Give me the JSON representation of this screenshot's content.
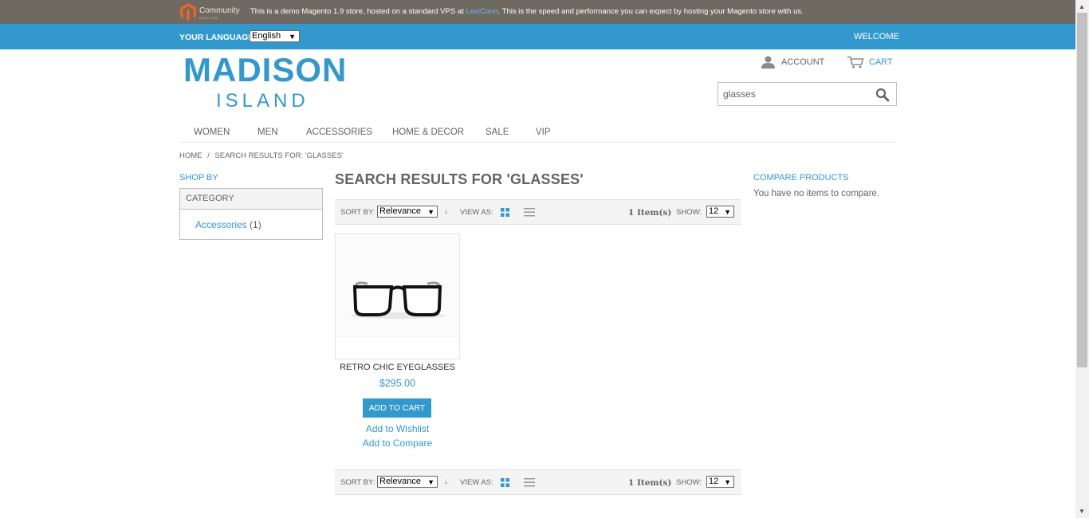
{
  "demo_bar": {
    "logo_text": "Community",
    "logo_sub": "EDITION",
    "text_before": "This is a demo Magento 1.9 store, hosted on a standard VPS at ",
    "link_text": "LexiConn",
    "text_after": ". This is the speed and performance you can expect by hosting your Magento store with us."
  },
  "lang_bar": {
    "label": "YOUR LANGUAGE:",
    "selected_language": "English",
    "welcome": "WELCOME"
  },
  "header": {
    "logo_main": "MADISON",
    "logo_sub": "ISLAND",
    "account_label": "ACCOUNT",
    "cart_label": "CART",
    "search_value": "glasses"
  },
  "nav": {
    "items": [
      "WOMEN",
      "MEN",
      "ACCESSORIES",
      "HOME & DECOR",
      "SALE",
      "VIP"
    ]
  },
  "breadcrumb": {
    "home": "HOME",
    "separator": "/",
    "current": "SEARCH RESULTS FOR: 'GLASSES'"
  },
  "sidebar": {
    "shop_by": "SHOP BY",
    "category_heading": "CATEGORY",
    "category_item": "Accessories",
    "category_count": "(1)"
  },
  "main": {
    "title": "SEARCH RESULTS FOR 'GLASSES'",
    "toolbar": {
      "sort_by_label": "SORT BY:",
      "sort_value": "Relevance",
      "view_as_label": "VIEW AS:",
      "count": "1 Item(s)",
      "show_label": "SHOW:",
      "show_value": "12"
    },
    "product": {
      "name": "RETRO CHIC EYEGLASSES",
      "price": "$295.00",
      "add_to_cart": "ADD TO CART",
      "wishlist": "Add to Wishlist",
      "compare": "Add to Compare"
    }
  },
  "compare": {
    "title": "COMPARE PRODUCTS",
    "empty_text": "You have no items to compare."
  },
  "colors": {
    "accent": "#3399cc",
    "demo_bar": "#6e6a62",
    "text": "#636363"
  }
}
